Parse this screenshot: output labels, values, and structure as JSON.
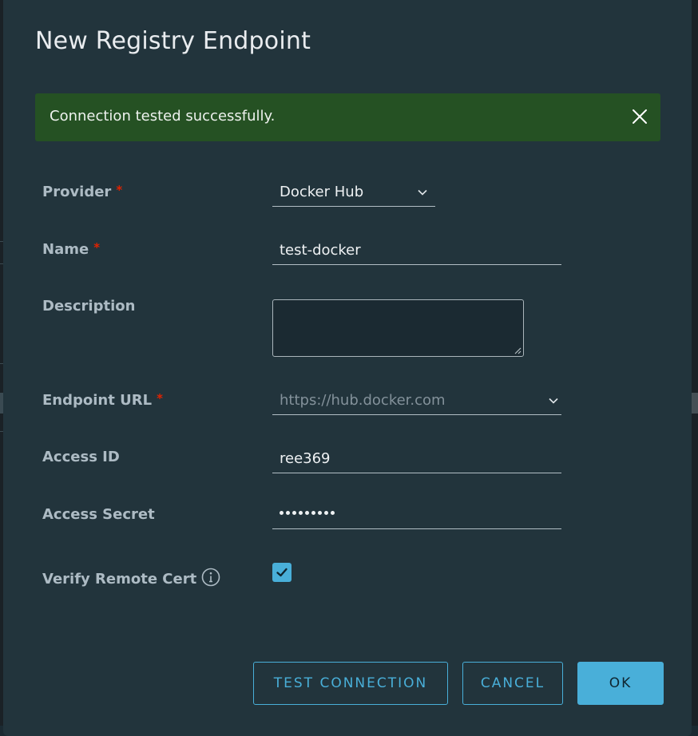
{
  "dialog": {
    "title": "New Registry Endpoint"
  },
  "alert": {
    "message": "Connection tested successfully.",
    "type": "success",
    "close_icon": "close-icon"
  },
  "form": {
    "required_marker": "*",
    "provider": {
      "label": "Provider",
      "value": "Docker Hub",
      "required": true
    },
    "name": {
      "label": "Name",
      "value": "test-docker",
      "required": true
    },
    "description": {
      "label": "Description",
      "value": ""
    },
    "endpoint_url": {
      "label": "Endpoint URL",
      "placeholder": "https://hub.docker.com",
      "required": true
    },
    "access_id": {
      "label": "Access ID",
      "value": "ree369"
    },
    "access_secret": {
      "label": "Access Secret",
      "masked_length": 9
    },
    "verify_remote_cert": {
      "label": "Verify Remote Cert",
      "checked": true,
      "info_icon": "info-icon"
    }
  },
  "buttons": {
    "test_connection": "TEST CONNECTION",
    "cancel": "CANCEL",
    "ok": "OK"
  },
  "colors": {
    "accent": "#49afd9",
    "success_bg": "#255123",
    "required": "#e12200",
    "modal_bg": "#22343c"
  }
}
